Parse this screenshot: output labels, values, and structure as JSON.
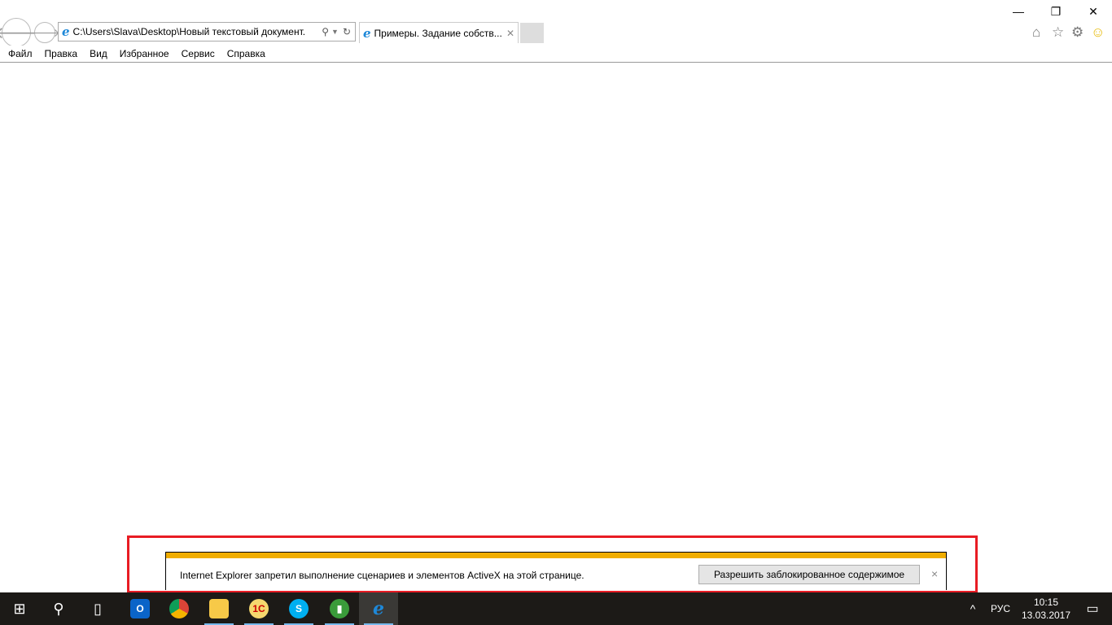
{
  "browser": {
    "address": "C:\\Users\\Slava\\Desktop\\Новый текстовый документ.",
    "tab_title": "Примеры. Задание собств...",
    "menu": [
      "Файл",
      "Правка",
      "Вид",
      "Избранное",
      "Сервис",
      "Справка"
    ]
  },
  "notification": {
    "message": "Internet Explorer запретил выполнение сценариев и элементов ActiveX на этой странице.",
    "allow_button": "Разрешить заблокированное содержимое",
    "close": "×"
  },
  "taskbar": {
    "language": "РУС",
    "time": "10:15",
    "date": "13.03.2017"
  },
  "colors": {
    "highlight": "#e81c24",
    "infobar": "#f0ad00"
  }
}
